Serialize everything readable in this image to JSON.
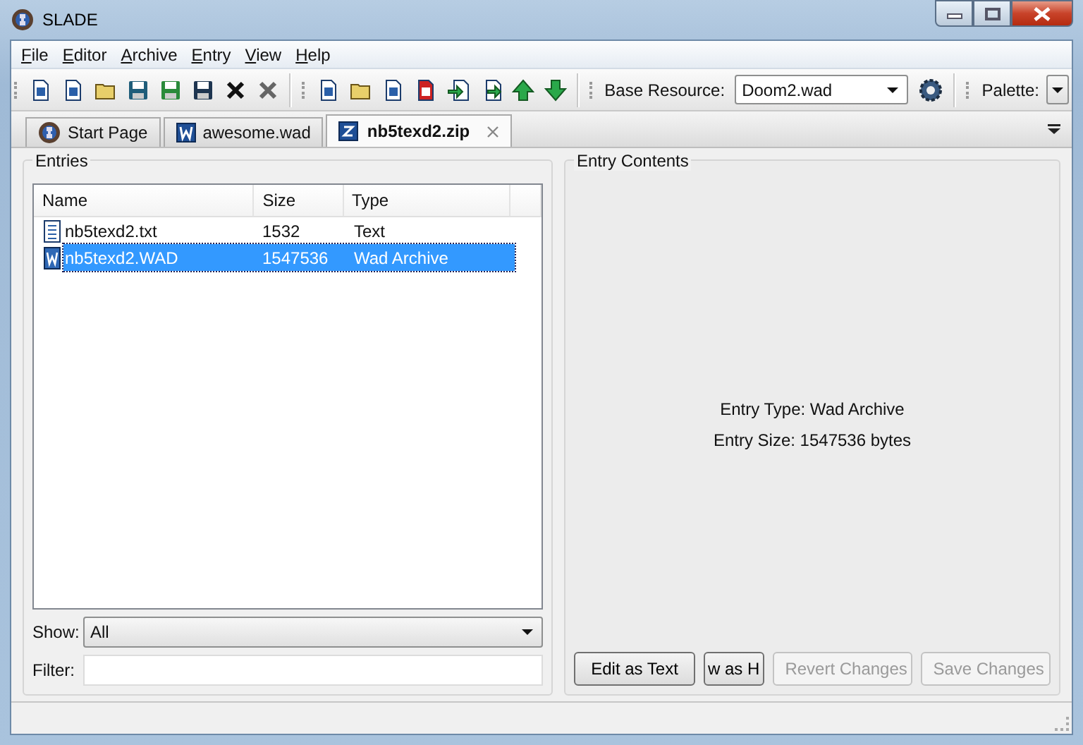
{
  "window": {
    "title": "SLADE"
  },
  "menu": [
    "File",
    "Editor",
    "Archive",
    "Entry",
    "View",
    "Help"
  ],
  "toolbar": {
    "base_resource_label": "Base Resource:",
    "base_resource": "Doom2.wad",
    "palette_label": "Palette:"
  },
  "tabs": [
    {
      "label": "Start Page",
      "kind": "start",
      "selected": false,
      "closable": false
    },
    {
      "label": "awesome.wad",
      "kind": "wad",
      "selected": false,
      "closable": false
    },
    {
      "label": "nb5texd2.zip",
      "kind": "zip",
      "selected": true,
      "closable": true
    }
  ],
  "entries": {
    "title": "Entries",
    "columns": [
      "Name",
      "Size",
      "Type"
    ],
    "rows": [
      {
        "kind": "text",
        "name": "nb5texd2.txt",
        "size": "1532",
        "type": "Text",
        "selected": false
      },
      {
        "kind": "wad",
        "name": "nb5texd2.WAD",
        "size": "1547536",
        "type": "Wad Archive",
        "selected": true
      }
    ],
    "show_label": "Show:",
    "show_value": "All",
    "filter_label": "Filter:"
  },
  "contents": {
    "title": "Entry Contents",
    "lines": [
      "Entry Type: Wad Archive",
      "Entry Size: 1547536 bytes"
    ],
    "buttons": [
      {
        "label": "Edit as Text",
        "disabled": false
      },
      {
        "label": "w as H",
        "disabled": false
      },
      {
        "label": "Revert Changes",
        "disabled": true
      },
      {
        "label": "Save Changes",
        "disabled": true
      }
    ]
  }
}
